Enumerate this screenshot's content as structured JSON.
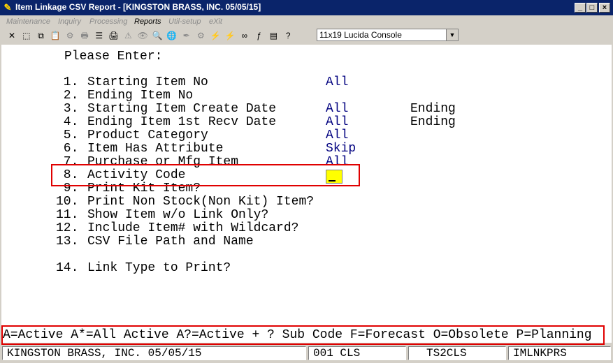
{
  "window": {
    "title": "Item Linkage CSV Report - [KINGSTON BRASS, INC. 05/05/15]",
    "app_icon": "✎",
    "minimize": "_",
    "maximize": "□",
    "close": "×"
  },
  "menu": [
    "Maintenance",
    "Inquiry",
    "Processing",
    "Reports",
    "Util-setup",
    "eXit"
  ],
  "toolbar": {
    "icons": [
      "close-icon",
      "select-icon",
      "copy-icon",
      "paste-icon",
      "settings-icon",
      "print-icon",
      "list-icon",
      "printer-icon",
      "alert-icon",
      "binoculars-icon",
      "search-icon",
      "globe-icon",
      "pen-icon",
      "gear-icon",
      "lightning-icon",
      "lightning-icon",
      "link-icon",
      "function-icon",
      "document-icon",
      "help-icon"
    ],
    "glyphs": [
      "✕",
      "⬚",
      "⧉",
      "📋",
      "⚙",
      "🖶",
      "☰",
      "🖨",
      "⚠",
      "👁",
      "🔍",
      "🌐",
      "✒",
      "⚙",
      "⚡",
      "⚡",
      "∞",
      "ƒ",
      "▤",
      "?"
    ],
    "font_select": "11x19 Lucida Console",
    "font_select_arrow": "▼"
  },
  "screen": {
    "prompt": "Please Enter:",
    "fields": [
      {
        "num": " 1.",
        "label": "Starting Item No",
        "value": "All",
        "ending": ""
      },
      {
        "num": " 2.",
        "label": "Ending Item No",
        "value": "",
        "ending": ""
      },
      {
        "num": " 3.",
        "label": "Starting Item Create Date",
        "value": "All",
        "ending": "Ending"
      },
      {
        "num": " 4.",
        "label": "Ending Item 1st Recv Date",
        "value": "All",
        "ending": "Ending"
      },
      {
        "num": " 5.",
        "label": "Product Category",
        "value": "All",
        "ending": ""
      },
      {
        "num": " 6.",
        "label": "Item Has Attribute",
        "value": "Skip",
        "ending": ""
      },
      {
        "num": " 7.",
        "label": "Purchase or Mfg Item",
        "value": "All",
        "ending": ""
      },
      {
        "num": " 8.",
        "label": "Activity Code",
        "value": "",
        "ending": ""
      },
      {
        "num": " 9.",
        "label": "Print Kit Item?",
        "value": "",
        "ending": ""
      },
      {
        "num": "10.",
        "label": "Print Non Stock(Non Kit) Item?",
        "value": "",
        "ending": ""
      },
      {
        "num": "11.",
        "label": "Show Item w/o Link Only?",
        "value": "",
        "ending": ""
      },
      {
        "num": "12.",
        "label": "Include Item# with Wildcard?",
        "value": "",
        "ending": ""
      },
      {
        "num": "13.",
        "label": "CSV File Path and Name",
        "value": "",
        "ending": ""
      },
      {
        "num": "14.",
        "label": "Link Type to Print?",
        "value": "",
        "ending": ""
      }
    ],
    "help_line": "A=Active A*=All Active A?=Active + ? Sub Code F=Forecast O=Obsolete P=Planning"
  },
  "status": {
    "company": "KINGSTON BRASS, INC. 05/05/15",
    "terminal": "001 CLS",
    "server": "TS2CLS",
    "program": "IMLNKPRS"
  }
}
